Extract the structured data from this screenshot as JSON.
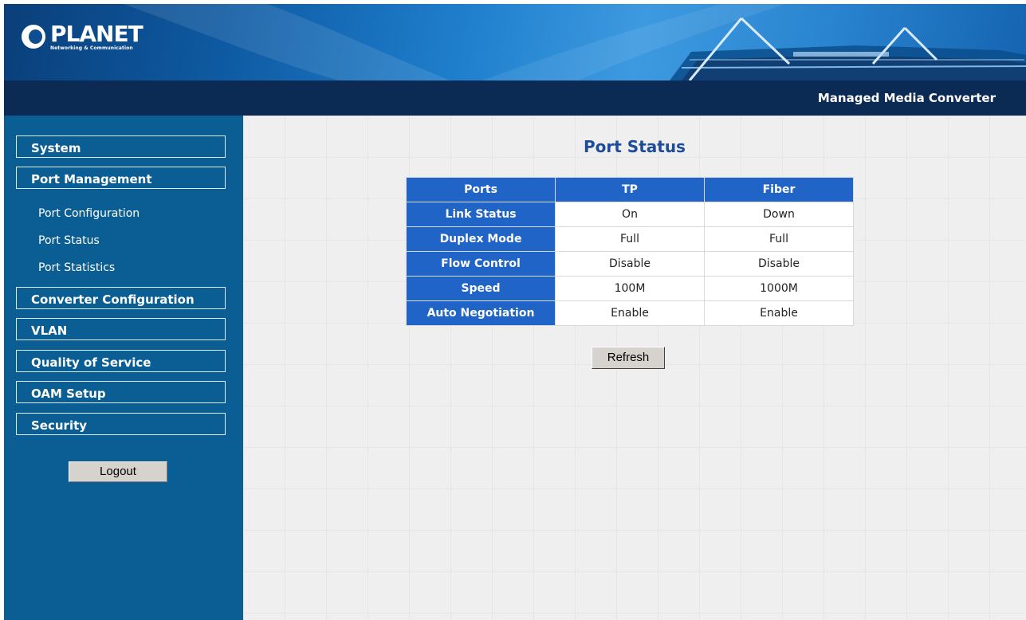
{
  "brand": {
    "name": "PLANET",
    "tagline": "Networking & Communication",
    "product": "Managed Media Converter"
  },
  "sidebar": {
    "items": [
      {
        "label": "System"
      },
      {
        "label": "Port Management"
      },
      {
        "label": "Converter Configuration"
      },
      {
        "label": "VLAN"
      },
      {
        "label": "Quality of Service"
      },
      {
        "label": "OAM Setup"
      },
      {
        "label": "Security"
      }
    ],
    "subitems": [
      {
        "label": "Port Configuration"
      },
      {
        "label": "Port Status"
      },
      {
        "label": "Port Statistics"
      }
    ],
    "logout_label": "Logout"
  },
  "main": {
    "title": "Port Status",
    "table": {
      "headers": [
        "Ports",
        "TP",
        "Fiber"
      ],
      "rows": [
        {
          "label": "Link Status",
          "tp": "On",
          "fiber": "Down"
        },
        {
          "label": "Duplex Mode",
          "tp": "Full",
          "fiber": "Full"
        },
        {
          "label": "Flow Control",
          "tp": "Disable",
          "fiber": "Disable"
        },
        {
          "label": "Speed",
          "tp": "100M",
          "fiber": "1000M"
        },
        {
          "label": "Auto Negotiation",
          "tp": "Enable",
          "fiber": "Enable"
        }
      ]
    },
    "refresh_label": "Refresh"
  },
  "colors": {
    "sidebar_bg": "#0b5e93",
    "titlebar_bg": "#0b2b55",
    "table_header": "#1f64c6",
    "title_text": "#1d4c99"
  }
}
